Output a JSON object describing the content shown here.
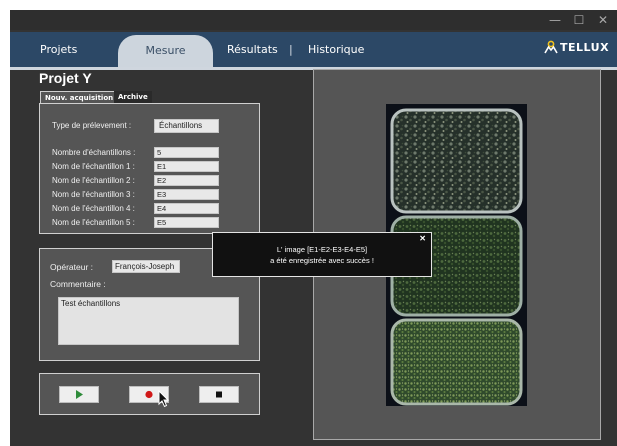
{
  "window": {
    "minimize_glyph": "—",
    "maximize_glyph": "☐",
    "close_glyph": "✕"
  },
  "nav": {
    "tabs": [
      {
        "label": "Projets"
      },
      {
        "label": "Mesure"
      },
      {
        "label": "Résultats"
      },
      {
        "label": "Historique"
      }
    ],
    "active": "Mesure",
    "separator": "|",
    "logo": "TELLUX"
  },
  "project": {
    "title": "Projet Y",
    "subtabs": [
      {
        "label": "Nouv. acquisition",
        "active": true
      },
      {
        "label": "Archive",
        "active": false
      }
    ]
  },
  "acquisition": {
    "type_label": "Type de prélevement :",
    "type_value": "Échantillons",
    "count_label": "Nombre d'échantillons :",
    "count_value": "5",
    "samples": [
      {
        "label": "Nom de l'échantillon 1 :",
        "value": "E1"
      },
      {
        "label": "Nom de l'échantillon 2 :",
        "value": "E2"
      },
      {
        "label": "Nom de l'échantillon 3 :",
        "value": "E3"
      },
      {
        "label": "Nom de l'échantillon 4 :",
        "value": "E4"
      },
      {
        "label": "Nom de l'échantillon 5 :",
        "value": "E5"
      }
    ]
  },
  "operator": {
    "label": "Opérateur :",
    "value": "François-Joseph",
    "comment_label": "Commentaire :",
    "comment_value": "Test échantillons"
  },
  "controls": {
    "play": "play-icon",
    "record": "record-icon",
    "stop": "stop-icon"
  },
  "toast": {
    "line1": "L' image [E1-E2-E3-E4-E5]",
    "line2": "a été enregistrée avec succès !",
    "close": "✕"
  },
  "colors": {
    "nav_bg": "#2c4866",
    "window_bg": "#333333",
    "panel_bg": "#555555",
    "logo_accent": "#f2c21b",
    "play_green": "#2e8b3a",
    "record_red": "#d01818"
  }
}
